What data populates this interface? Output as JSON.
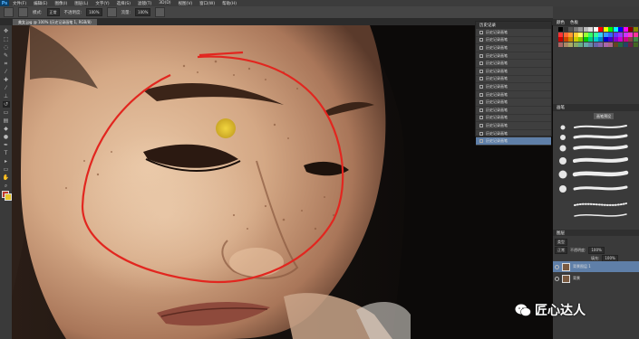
{
  "menubar": {
    "logo": "Ps",
    "items": [
      "文件(F)",
      "编辑(E)",
      "图像(I)",
      "图层(L)",
      "文字(Y)",
      "选择(S)",
      "滤镜(T)",
      "3D(D)",
      "视图(V)",
      "窗口(W)",
      "帮助(H)"
    ]
  },
  "options": {
    "mode_label": "模式:",
    "mode_value": "正常",
    "opacity_label": "不透明度:",
    "opacity_value": "100%",
    "flow_label": "流量:",
    "flow_value": "100%"
  },
  "document": {
    "tab": "美女.jpg @ 100% (历史记录画笔 1, RGB/8)"
  },
  "history_panel": {
    "title": "历史记录",
    "items": [
      "历史记录画笔",
      "历史记录画笔",
      "历史记录画笔",
      "历史记录画笔",
      "历史记录画笔",
      "历史记录画笔",
      "历史记录画笔",
      "历史记录画笔",
      "历史记录画笔",
      "历史记录画笔",
      "历史记录画笔",
      "历史记录画笔",
      "历史记录画笔",
      "历史记录画笔",
      "历史记录画笔"
    ],
    "selected_index": 14
  },
  "swatches_panel": {
    "tabs": [
      "颜色",
      "色板"
    ]
  },
  "brush_panel": {
    "title": "画笔",
    "preset_button": "画笔预设"
  },
  "layers_panel": {
    "title": "图层",
    "kind_label": "类型",
    "blend_mode": "正常",
    "opacity_label": "不透明度:",
    "opacity_value": "100%",
    "fill_label": "填充:",
    "fill_value": "100%",
    "layers": [
      {
        "name": "背景图层 1",
        "selected": true
      },
      {
        "name": "背景",
        "selected": false
      }
    ]
  },
  "watermark": {
    "text": "匠心达人"
  },
  "colors": {
    "accent": "#5f7fa8",
    "annotation_stroke": "#e2261f",
    "cursor": "#e8c52a"
  }
}
